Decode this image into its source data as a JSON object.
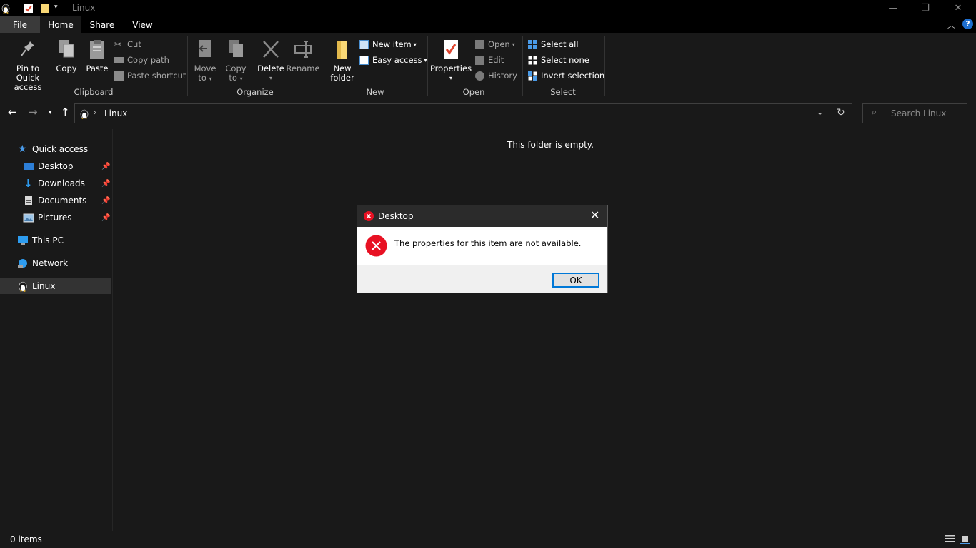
{
  "window": {
    "title": "Linux",
    "minimize_glyph": "—",
    "restore_glyph": "❐",
    "close_glyph": "✕"
  },
  "ribbon_tabs": [
    "File",
    "Home",
    "Share",
    "View"
  ],
  "ribbon": {
    "clipboard": {
      "label": "Clipboard",
      "pin_to_quick_access": "Pin to Quick",
      "pin_to_quick_access_2": "access",
      "copy": "Copy",
      "paste": "Paste",
      "cut": "Cut",
      "copy_path": "Copy path",
      "paste_shortcut": "Paste shortcut"
    },
    "organize": {
      "label": "Organize",
      "move_to": "Move",
      "move_to_2": "to",
      "copy_to": "Copy",
      "copy_to_2": "to",
      "delete": "Delete",
      "rename": "Rename"
    },
    "new": {
      "label": "New",
      "new_folder": "New",
      "new_folder_2": "folder",
      "new_item": "New item",
      "easy_access": "Easy access"
    },
    "open": {
      "label": "Open",
      "properties": "Properties",
      "open": "Open",
      "edit": "Edit",
      "history": "History"
    },
    "select": {
      "label": "Select",
      "select_all": "Select all",
      "select_none": "Select none",
      "invert_selection": "Invert selection"
    }
  },
  "address_bar": {
    "path": "Linux",
    "search_placeholder": "Search Linux"
  },
  "nav_pane": {
    "quick_access": "Quick access",
    "items": [
      "Desktop",
      "Downloads",
      "Documents",
      "Pictures"
    ],
    "this_pc": "This PC",
    "network": "Network",
    "linux": "Linux"
  },
  "content": {
    "empty_message": "This folder is empty."
  },
  "status_bar": {
    "item_count": "0 items"
  },
  "dialog": {
    "title": "Desktop",
    "message": "The properties for this item are not available.",
    "ok_label": "OK"
  },
  "colors": {
    "accent": "#0078d7",
    "error": "#e81123",
    "folder": "#f8d775",
    "background": "#191919"
  }
}
